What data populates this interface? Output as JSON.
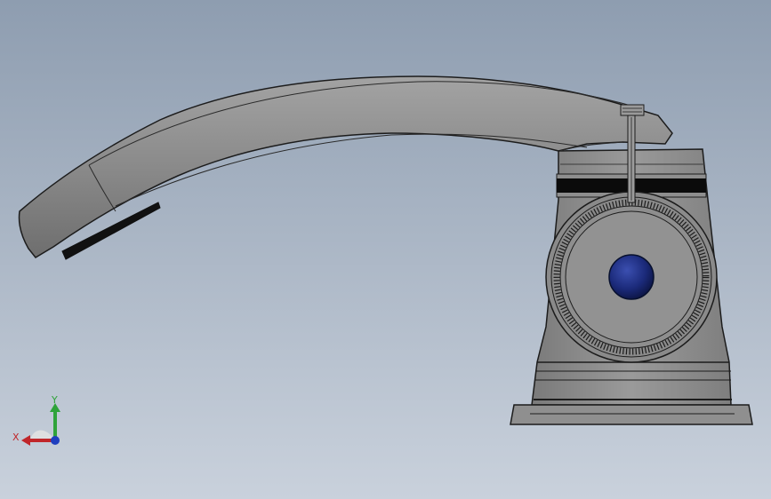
{
  "viewport": {
    "background_top": "#8e9db0",
    "background_bottom": "#c9d1dc"
  },
  "model": {
    "body_color": "#8c8c8c",
    "handle_knob_color": "#1b2a7a"
  },
  "triad": {
    "x_label": "X",
    "y_label": "Y",
    "x_color": "#c0262a",
    "y_color": "#2fa33a",
    "z_color": "#1f3fbf"
  }
}
